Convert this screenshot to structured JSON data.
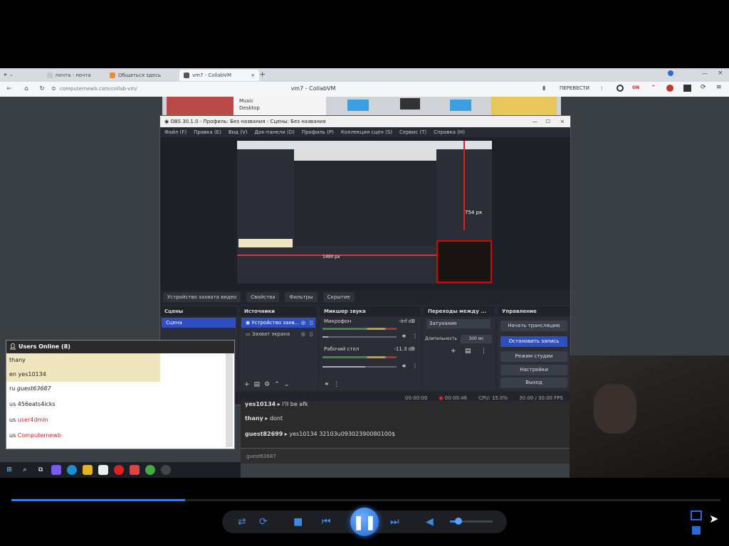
{
  "browser": {
    "tabs": [
      {
        "label": "почта - почта",
        "color": "#c3c7cc"
      },
      {
        "label": "Общаться здесь",
        "color": "#f08c2a"
      },
      {
        "label": "vm7 - CollabVM",
        "color": "#555555"
      }
    ],
    "url": "computernewb.com/collab-vm/",
    "page_title": "vm7 - CollabVM",
    "translate_label": "ПЕРЕВЕСТИ"
  },
  "desktop": {
    "folders": [
      "Music",
      "Desktop"
    ]
  },
  "obs": {
    "title": "OBS 30.1.0 - Профиль: Без названия - Сцены: Без названия",
    "menu": [
      "Файл (F)",
      "Правка (E)",
      "Вид (V)",
      "Док-панели (D)",
      "Профиль (P)",
      "Коллекция сцен (S)",
      "Сервис (T)",
      "Справка (H)"
    ],
    "measure_label": "754 px",
    "source_bar": [
      "Устройство захвата видео",
      "Свойства",
      "Фильтры",
      "Скрытие"
    ],
    "scenes": {
      "header": "Сцены",
      "items": [
        "Сцена"
      ]
    },
    "sources": {
      "header": "Источники",
      "items": [
        "Устройство захв...",
        "Захват экрана"
      ]
    },
    "mixer": {
      "header": "Микшер звука",
      "channels": [
        {
          "name": "Микрофон",
          "db": "-inf dB",
          "level": 0.0,
          "volume": 0.08
        },
        {
          "name": "Рабочий стол",
          "db": "-11.3 dB",
          "level": 0.55,
          "volume": 0.58
        }
      ]
    },
    "transitions": {
      "header": "Переходы между ...",
      "type": "Затухание",
      "duration_label": "Длительность",
      "duration": "300 мс"
    },
    "controls": {
      "header": "Управление",
      "buttons": [
        "Начать трансляцию",
        "Остановить запись",
        "Режим студии",
        "Настройки",
        "Выход"
      ]
    },
    "status": [
      "00:00:00",
      "00:00:46",
      "CPU: 15.0%",
      "30.00 / 30.00 FPS"
    ]
  },
  "users_panel": {
    "header": "Users Online (8)",
    "users": [
      {
        "name": "thany",
        "color": "#222222",
        "hl": true
      },
      {
        "name": "yes10134",
        "flag": "en",
        "color": "#222222",
        "hl": true
      },
      {
        "name": "guest63687",
        "flag": "ru",
        "color": "#222222",
        "hl": false
      },
      {
        "name": "456eats4icks",
        "flag": "us",
        "color": "#222222",
        "hl": false
      },
      {
        "name": "user4dmin",
        "flag": "us",
        "color": "#d62020",
        "hl": false
      },
      {
        "name": "Computernewb",
        "flag": "us",
        "color": "#d62020",
        "hl": false
      }
    ]
  },
  "chat": {
    "lines": [
      {
        "user": "yes10134",
        "text": "i'll be afk"
      },
      {
        "user": "thany",
        "text": "dont"
      },
      {
        "user": "guest82699",
        "text": "yes10134 32103u09302390080100$"
      }
    ],
    "input_placeholder": "guest63687"
  },
  "player": {
    "progress": 0.245,
    "volume": 0.2
  }
}
